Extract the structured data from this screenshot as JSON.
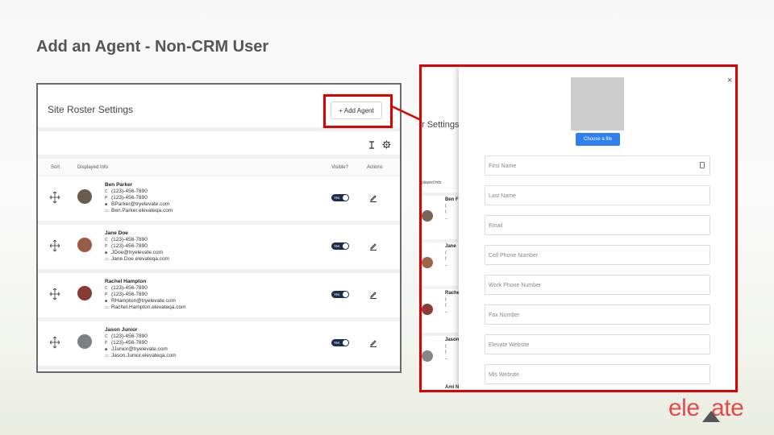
{
  "slide": {
    "title": "Add an Agent - Non-CRM User"
  },
  "roster": {
    "title": "Site Roster Settings",
    "add_button": "+ Add Agent",
    "columns": {
      "sort": "Sort",
      "info": "Displayed Info",
      "visible": "Visible?",
      "actions": "Actions"
    },
    "agents": [
      {
        "name": "Ben Parker",
        "phone1": "(123)-456-7890",
        "phone2": "(123)-456-7890",
        "email": "BParker@tryelevate.com",
        "site": "Ben.Parker.elevateqa.com",
        "visible": "Yes",
        "avatar_color": "#6b5a4f"
      },
      {
        "name": "Jane Doe",
        "phone1": "(123)-456-7890",
        "phone2": "(123)-456-7890",
        "email": "JDoe@tryelevate.com",
        "site": "Jane.Doe.elevateqa.com",
        "visible": "Yes",
        "avatar_color": "#9a5b45"
      },
      {
        "name": "Rachel Hampton",
        "phone1": "(123)-456-7890",
        "phone2": "(123)-456-7890",
        "email": "RHampton@tryelevate.com",
        "site": "Rachel.Hampton.elevateqa.com",
        "visible": "Yes",
        "avatar_color": "#8a3a35"
      },
      {
        "name": "Jason Junior",
        "phone1": "(123)-456-7890",
        "phone2": "(123)-456-7890",
        "email": "JJunior@tryelevate.com",
        "site": "Jason.Junior.elevateqa.com",
        "visible": "Yes",
        "avatar_color": "#7d7f80"
      }
    ]
  },
  "background_strip": {
    "title_fragment": "r Settings",
    "col_fragment": "played Info",
    "rows": [
      {
        "name": "Ben F",
        "avatar_color": "#7a6455"
      },
      {
        "name": "Jane",
        "avatar_color": "#a0644b"
      },
      {
        "name": "Rache",
        "avatar_color": "#8c3b36"
      },
      {
        "name": "Jason",
        "avatar_color": "#848688"
      }
    ],
    "last_fragment": "Ami N",
    "line_glyph": "(",
    "dash_glyph": "_"
  },
  "modal": {
    "close": "×",
    "choose_file": "Choose a file",
    "fields": [
      {
        "placeholder": "First Name",
        "has_icon": true
      },
      {
        "placeholder": "Last Name"
      },
      {
        "placeholder": "Email"
      },
      {
        "placeholder": "Cell Phone Number"
      },
      {
        "placeholder": "Work Phone Number"
      },
      {
        "placeholder": "Fax Number"
      },
      {
        "placeholder": "Elevate Website"
      },
      {
        "placeholder": "Mls Website"
      }
    ]
  },
  "icons": {
    "phone_c": "C",
    "phone_p": "P",
    "email": "mail-icon",
    "site": "link-icon"
  },
  "logo": {
    "text_left": "ele",
    "text_right": "ate",
    "color": "#e24a4a",
    "triangle_color": "#555555"
  },
  "colors": {
    "highlight": "#e00000",
    "toggle": "#1f2d4d",
    "button": "#2f80ed"
  }
}
